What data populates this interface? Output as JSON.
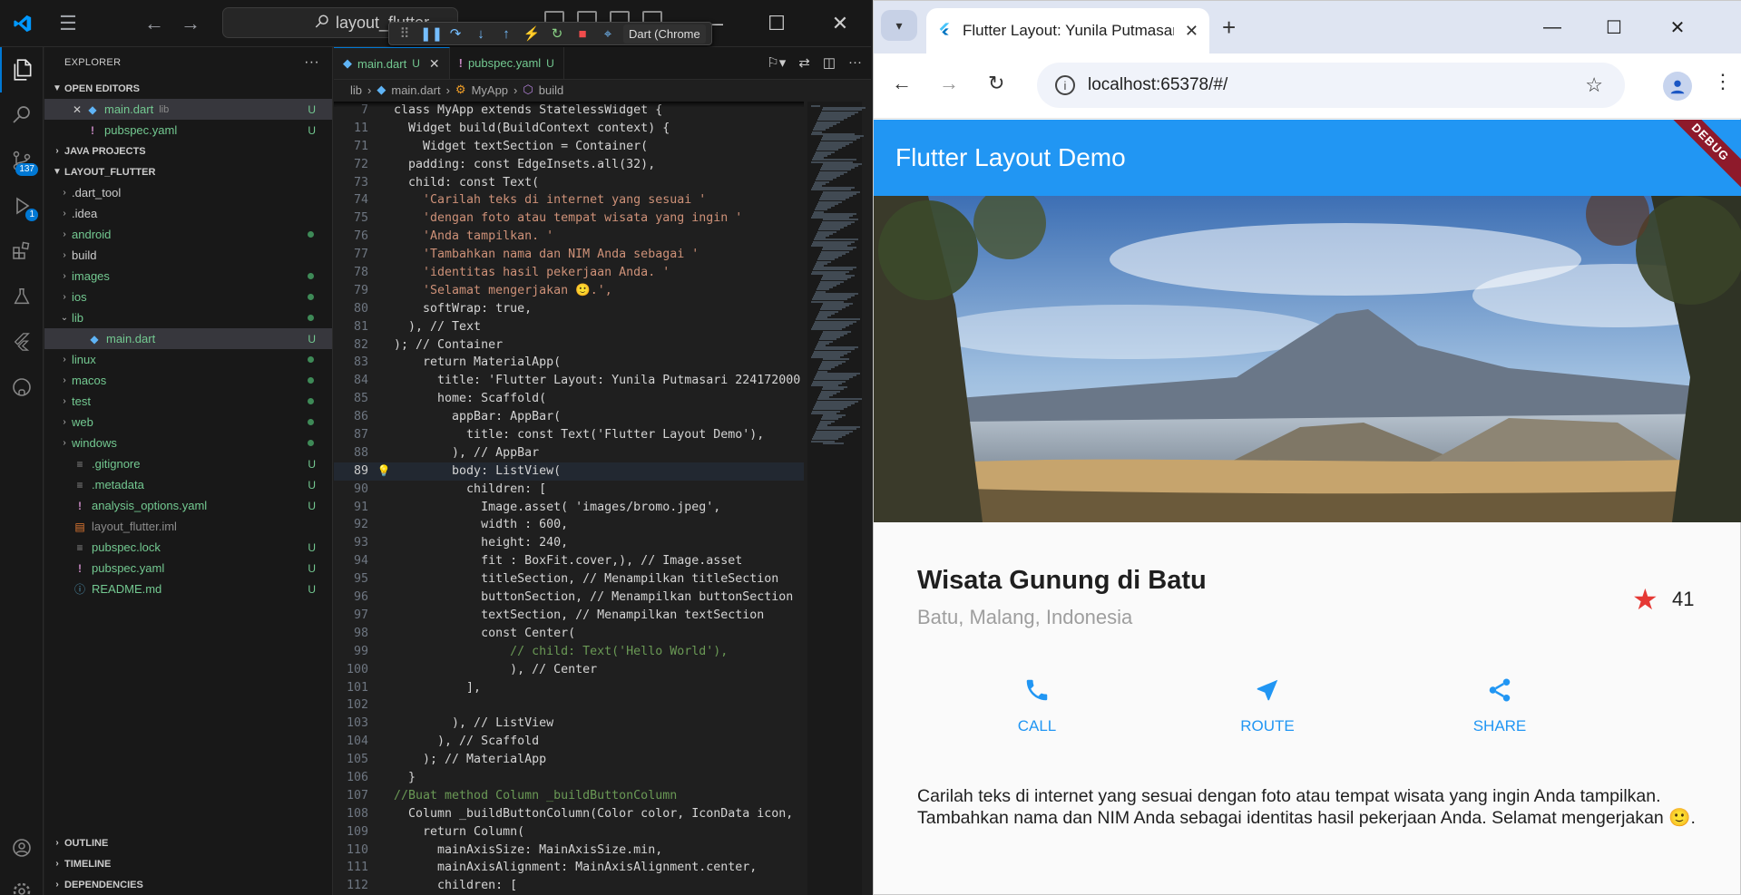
{
  "vscode": {
    "search_text": "layout_flutter",
    "debug_config": "Dart (Chrome",
    "badges": {
      "source_control": "137",
      "run_debug": "1"
    },
    "explorer_title": "EXPLORER",
    "open_editors_title": "OPEN EDITORS",
    "open_editors": [
      {
        "name": "main.dart",
        "path": "lib",
        "status": "U"
      },
      {
        "name": "pubspec.yaml",
        "status": "U"
      }
    ],
    "java_projects_title": "JAVA PROJECTS",
    "project_title": "LAYOUT_FLUTTER",
    "tree": [
      {
        "name": ".dart_tool",
        "type": "folder"
      },
      {
        "name": ".idea",
        "type": "folder"
      },
      {
        "name": "android",
        "type": "folder",
        "dot": true
      },
      {
        "name": "build",
        "type": "folder"
      },
      {
        "name": "images",
        "type": "folder",
        "dot": true
      },
      {
        "name": "ios",
        "type": "folder",
        "dot": true
      },
      {
        "name": "lib",
        "type": "folder-open",
        "dot": true
      },
      {
        "name": "main.dart",
        "type": "file-child",
        "status": "U"
      },
      {
        "name": "linux",
        "type": "folder",
        "dot": true
      },
      {
        "name": "macos",
        "type": "folder",
        "dot": true
      },
      {
        "name": "test",
        "type": "folder",
        "dot": true
      },
      {
        "name": "web",
        "type": "folder",
        "dot": true
      },
      {
        "name": "windows",
        "type": "folder",
        "dot": true
      },
      {
        "name": ".gitignore",
        "type": "file",
        "status": "U"
      },
      {
        "name": ".metadata",
        "type": "file",
        "status": "U"
      },
      {
        "name": "analysis_options.yaml",
        "type": "file",
        "status": "U"
      },
      {
        "name": "layout_flutter.iml",
        "type": "file"
      },
      {
        "name": "pubspec.lock",
        "type": "file",
        "status": "U"
      },
      {
        "name": "pubspec.yaml",
        "type": "file",
        "status": "U"
      },
      {
        "name": "README.md",
        "type": "file",
        "status": "U"
      }
    ],
    "bottom_sections": [
      "OUTLINE",
      "TIMELINE",
      "DEPENDENCIES"
    ],
    "tabs": [
      {
        "label": "main.dart",
        "status": "U",
        "active": true
      },
      {
        "label": "pubspec.yaml",
        "status": "U",
        "active": false
      }
    ],
    "breadcrumbs": [
      "lib",
      "main.dart",
      "MyApp",
      "build"
    ],
    "code_lines": [
      {
        "n": "7",
        "t": "class MyApp extends StatelessWidget {"
      },
      {
        "n": "11",
        "t": "  Widget build(BuildContext context) {"
      },
      {
        "n": "71",
        "t": "    Widget textSection = Container("
      },
      {
        "n": "72",
        "t": "  padding: const EdgeInsets.all(32),"
      },
      {
        "n": "73",
        "t": "  child: const Text("
      },
      {
        "n": "74",
        "t": "    'Carilah teks di internet yang sesuai '"
      },
      {
        "n": "75",
        "t": "    'dengan foto atau tempat wisata yang ingin '"
      },
      {
        "n": "76",
        "t": "    'Anda tampilkan. '"
      },
      {
        "n": "77",
        "t": "    'Tambahkan nama dan NIM Anda sebagai '"
      },
      {
        "n": "78",
        "t": "    'identitas hasil pekerjaan Anda. '"
      },
      {
        "n": "79",
        "t": "    'Selamat mengerjakan 🙂.',"
      },
      {
        "n": "80",
        "t": "    softWrap: true,"
      },
      {
        "n": "81",
        "t": "  ), // Text"
      },
      {
        "n": "82",
        "t": "); // Container"
      },
      {
        "n": "83",
        "t": "    return MaterialApp("
      },
      {
        "n": "84",
        "t": "      title: 'Flutter Layout: Yunila Putmasari 224172000"
      },
      {
        "n": "85",
        "t": "      home: Scaffold("
      },
      {
        "n": "86",
        "t": "        appBar: AppBar("
      },
      {
        "n": "87",
        "t": "          title: const Text('Flutter Layout Demo'),"
      },
      {
        "n": "88",
        "t": "        ), // AppBar"
      },
      {
        "n": "89",
        "t": "        body: ListView("
      },
      {
        "n": "90",
        "t": "          children: ["
      },
      {
        "n": "91",
        "t": "            Image.asset( 'images/bromo.jpeg',"
      },
      {
        "n": "92",
        "t": "            width : 600,"
      },
      {
        "n": "93",
        "t": "            height: 240,"
      },
      {
        "n": "94",
        "t": "            fit : BoxFit.cover,), // Image.asset"
      },
      {
        "n": "95",
        "t": "            titleSection, // Menampilkan titleSection"
      },
      {
        "n": "96",
        "t": "            buttonSection, // Menampilkan buttonSection"
      },
      {
        "n": "97",
        "t": "            textSection, // Menampilkan textSection"
      },
      {
        "n": "98",
        "t": "            const Center("
      },
      {
        "n": "99",
        "t": "                // child: Text('Hello World'),"
      },
      {
        "n": "100",
        "t": "                ), // Center"
      },
      {
        "n": "101",
        "t": "          ],"
      },
      {
        "n": "102",
        "t": ""
      },
      {
        "n": "103",
        "t": "        ), // ListView"
      },
      {
        "n": "104",
        "t": "      ), // Scaffold"
      },
      {
        "n": "105",
        "t": "    ); // MaterialApp"
      },
      {
        "n": "106",
        "t": "  }"
      },
      {
        "n": "107",
        "t": "//Buat method Column _buildButtonColumn"
      },
      {
        "n": "108",
        "t": "  Column _buildButtonColumn(Color color, IconData icon,"
      },
      {
        "n": "109",
        "t": "    return Column("
      },
      {
        "n": "110",
        "t": "      mainAxisSize: MainAxisSize.min,"
      },
      {
        "n": "111",
        "t": "      mainAxisAlignment: MainAxisAlignment.center,"
      },
      {
        "n": "112",
        "t": "      children: ["
      }
    ],
    "current_line": "89"
  },
  "browser": {
    "tab_title": "Flutter Layout: Yunila Putmasari",
    "url": "localhost:65378/#/",
    "app": {
      "appbar_title": "Flutter Layout Demo",
      "debug_banner": "DEBUG",
      "place_name": "Wisata Gunung di Batu",
      "place_location": "Batu, Malang, Indonesia",
      "favorite_count": "41",
      "buttons": [
        {
          "label": "CALL",
          "icon": "phone-icon"
        },
        {
          "label": "ROUTE",
          "icon": "navigation-icon"
        },
        {
          "label": "SHARE",
          "icon": "share-icon"
        }
      ],
      "description": "Carilah teks di internet yang sesuai dengan foto atau tempat wisata yang ingin Anda tampilkan. Tambahkan nama dan NIM Anda sebagai identitas hasil pekerjaan Anda. Selamat mengerjakan 🙂.",
      "colors": {
        "primary": "#2196f3",
        "star": "#e53935"
      }
    }
  }
}
